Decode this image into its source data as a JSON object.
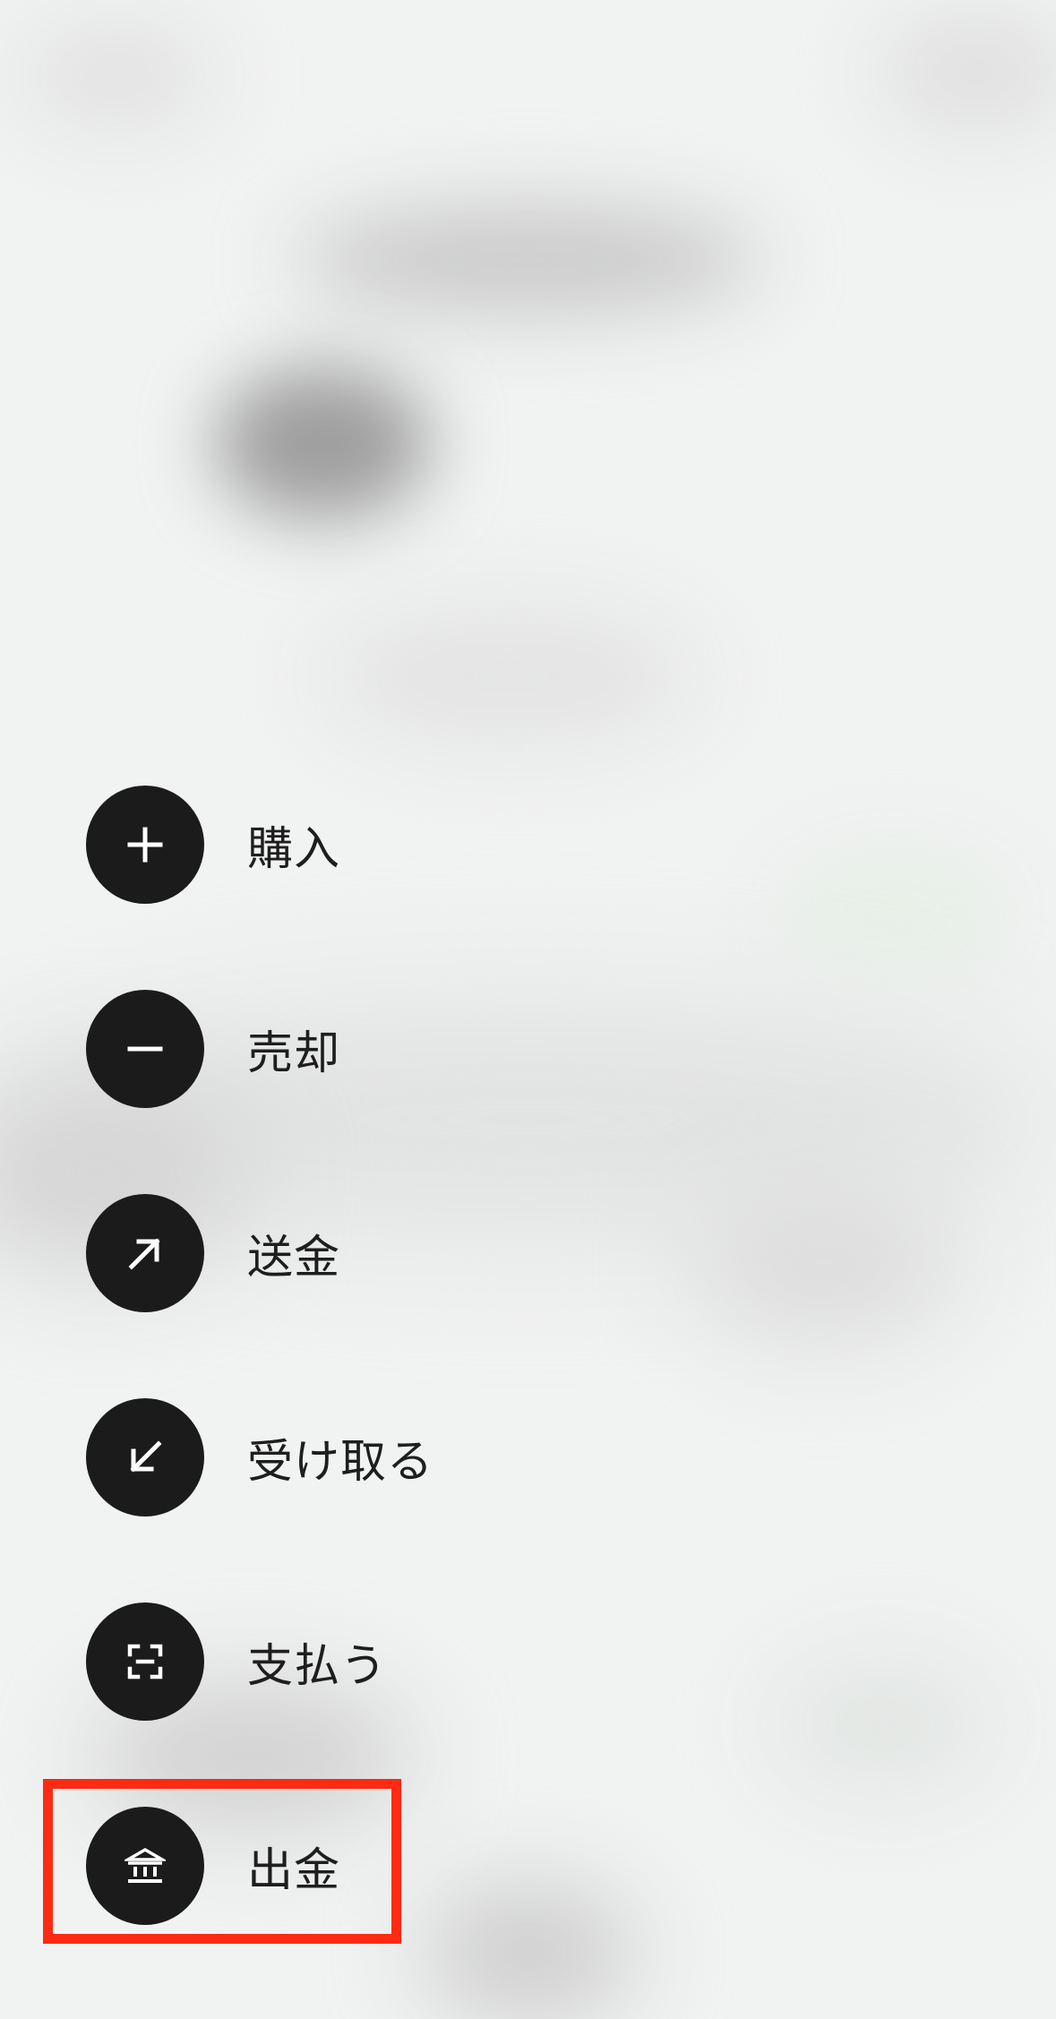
{
  "menu": {
    "items": [
      {
        "label": "購入",
        "icon": "plus-icon"
      },
      {
        "label": "売却",
        "icon": "minus-icon"
      },
      {
        "label": "送金",
        "icon": "arrow-up-right-icon"
      },
      {
        "label": "受け取る",
        "icon": "arrow-down-left-icon"
      },
      {
        "label": "支払う",
        "icon": "scan-icon"
      },
      {
        "label": "出金",
        "icon": "bank-icon"
      }
    ]
  },
  "colors": {
    "background": "#f1f2f2",
    "icon_circle": "#1b1b1b",
    "icon_glyph": "#ffffff",
    "label_text": "#1e1e1e",
    "highlight": "#ff2a12"
  }
}
